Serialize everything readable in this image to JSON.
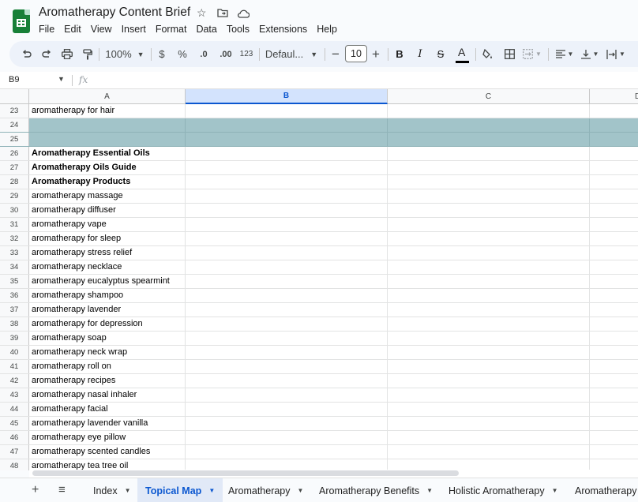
{
  "title": "Aromatherapy Content Brief",
  "menu": [
    "File",
    "Edit",
    "View",
    "Insert",
    "Format",
    "Data",
    "Tools",
    "Extensions",
    "Help"
  ],
  "toolbar": {
    "zoom": "100%",
    "currency": "$",
    "percent": "%",
    "dec_decrease": ".0",
    "dec_increase": ".00",
    "number_format": "123",
    "font": "Defaul...",
    "font_size": "10",
    "bold": "B",
    "italic": "I",
    "strike": "S",
    "text_color": "A"
  },
  "formula_bar": {
    "cell_ref": "B9",
    "fx": "fx",
    "content": ""
  },
  "columns": [
    "A",
    "B",
    "C",
    "D"
  ],
  "selected_column": "B",
  "rows": [
    {
      "num": "23",
      "a": "aromatherapy for hair",
      "style": ""
    },
    {
      "num": "24",
      "a": "",
      "style": "teal"
    },
    {
      "num": "25",
      "a": "",
      "style": "teal"
    },
    {
      "num": "26",
      "a": "Aromatherapy Essential Oils",
      "style": "bold"
    },
    {
      "num": "27",
      "a": "Aromatherapy Oils Guide",
      "style": "bold"
    },
    {
      "num": "28",
      "a": "Aromatherapy Products",
      "style": "bold"
    },
    {
      "num": "29",
      "a": "aromatherapy massage",
      "style": ""
    },
    {
      "num": "30",
      "a": "aromatherapy diffuser",
      "style": ""
    },
    {
      "num": "31",
      "a": "aromatherapy vape",
      "style": ""
    },
    {
      "num": "32",
      "a": "aromatherapy for sleep",
      "style": ""
    },
    {
      "num": "33",
      "a": "aromatherapy stress relief",
      "style": ""
    },
    {
      "num": "34",
      "a": "aromatherapy necklace",
      "style": ""
    },
    {
      "num": "35",
      "a": "aromatherapy eucalyptus spearmint",
      "style": ""
    },
    {
      "num": "36",
      "a": "aromatherapy shampoo",
      "style": ""
    },
    {
      "num": "37",
      "a": "aromatherapy lavender",
      "style": ""
    },
    {
      "num": "38",
      "a": "aromatherapy for depression",
      "style": ""
    },
    {
      "num": "39",
      "a": "aromatherapy soap",
      "style": ""
    },
    {
      "num": "40",
      "a": "aromatherapy neck wrap",
      "style": ""
    },
    {
      "num": "41",
      "a": "aromatherapy roll on",
      "style": ""
    },
    {
      "num": "42",
      "a": "aromatherapy recipes",
      "style": ""
    },
    {
      "num": "43",
      "a": "aromatherapy nasal inhaler",
      "style": ""
    },
    {
      "num": "44",
      "a": "aromatherapy facial",
      "style": ""
    },
    {
      "num": "45",
      "a": "aromatherapy lavender vanilla",
      "style": ""
    },
    {
      "num": "46",
      "a": "aromatherapy eye pillow",
      "style": ""
    },
    {
      "num": "47",
      "a": "aromatherapy scented candles",
      "style": ""
    },
    {
      "num": "48",
      "a": "aromatherapy tea tree oil",
      "style": ""
    }
  ],
  "sheet_tabs": [
    {
      "label": "Index",
      "active": false
    },
    {
      "label": "Topical Map",
      "active": true
    },
    {
      "label": "Aromatherapy",
      "active": false
    },
    {
      "label": "Aromatherapy Benefits",
      "active": false
    },
    {
      "label": "Holistic Aromatherapy",
      "active": false
    },
    {
      "label": "Aromatherapy",
      "active": false
    }
  ],
  "colors": {
    "band": "#a2c4c9",
    "accent": "#0b57d0",
    "selected_header": "#d3e3fd"
  }
}
